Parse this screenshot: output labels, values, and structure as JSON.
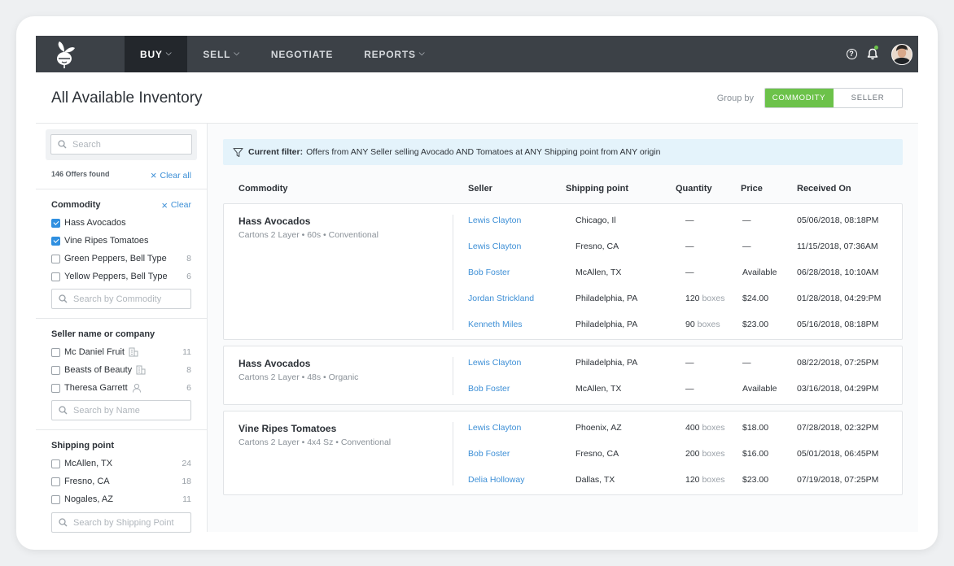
{
  "nav": {
    "items": [
      {
        "label": "BUY",
        "chevron": true
      },
      {
        "label": "SELL",
        "chevron": true
      },
      {
        "label": "NEGOTIATE",
        "chevron": false
      },
      {
        "label": "REPORTS",
        "chevron": true
      }
    ],
    "help_glyph": "?",
    "icons": [
      "help-icon",
      "bell-icon",
      "avatar"
    ]
  },
  "header": {
    "title": "All Available Inventory",
    "group_by_label": "Group by",
    "group_options": [
      "COMMODITY",
      "SELLER"
    ],
    "group_selected": "COMMODITY"
  },
  "sidebar": {
    "search_placeholder": "Search",
    "results_count": "146 Offers found",
    "clear_all": "Clear all",
    "commodity": {
      "title": "Commodity",
      "clear": "Clear",
      "items": [
        {
          "label": "Hass Avocados",
          "checked": true,
          "count": ""
        },
        {
          "label": "Vine Ripes Tomatoes",
          "checked": true,
          "count": ""
        },
        {
          "label": "Green Peppers, Bell Type",
          "checked": false,
          "count": "8"
        },
        {
          "label": "Yellow Peppers, Bell Type",
          "checked": false,
          "count": "6"
        }
      ],
      "search_placeholder": "Search by Commodity"
    },
    "seller": {
      "title": "Seller name or company",
      "items": [
        {
          "label": "Mc Daniel Fruit",
          "icon": "building-icon",
          "checked": false,
          "count": "11"
        },
        {
          "label": "Beasts of Beauty",
          "icon": "building-icon",
          "checked": false,
          "count": "8"
        },
        {
          "label": "Theresa Garrett",
          "icon": "person-icon",
          "checked": false,
          "count": "6"
        }
      ],
      "search_placeholder": "Search by Name"
    },
    "shipping": {
      "title": "Shipping point",
      "items": [
        {
          "label": "McAllen, TX",
          "checked": false,
          "count": "24"
        },
        {
          "label": "Fresno, CA",
          "checked": false,
          "count": "18"
        },
        {
          "label": "Nogales, AZ",
          "checked": false,
          "count": "11"
        }
      ],
      "search_placeholder": "Search by Shipping Point"
    }
  },
  "filter": {
    "label": "Current filter:",
    "text": "Offers from ANY Seller selling Avocado AND Tomatoes at ANY Shipping point from ANY origin"
  },
  "table": {
    "columns": [
      "Commodity",
      "Seller",
      "Shipping point",
      "Quantity",
      "Price",
      "Received On"
    ],
    "groups": [
      {
        "name": "Hass Avocados",
        "desc": "Cartons 2 Layer • 60s • Conventional",
        "rows": [
          {
            "seller": "Lewis Clayton",
            "ship": "Chicago, Il",
            "qty": "—",
            "unit": "",
            "price": "—",
            "received": "05/06/2018, 08:18PM"
          },
          {
            "seller": "Lewis Clayton",
            "ship": "Fresno, CA",
            "qty": "—",
            "unit": "",
            "price": "—",
            "received": "11/15/2018, 07:36AM"
          },
          {
            "seller": "Bob Foster",
            "ship": "McAllen, TX",
            "qty": "—",
            "unit": "",
            "price": "Available",
            "received": "06/28/2018, 10:10AM"
          },
          {
            "seller": "Jordan Strickland",
            "ship": "Philadelphia, PA",
            "qty": "120",
            "unit": "boxes",
            "price": "$24.00",
            "received": "01/28/2018, 04:29:PM"
          },
          {
            "seller": "Kenneth Miles",
            "ship": "Philadelphia, PA",
            "qty": "90",
            "unit": "boxes",
            "price": "$23.00",
            "received": "05/16/2018, 08:18PM"
          }
        ]
      },
      {
        "name": "Hass Avocados",
        "desc": "Cartons 2 Layer • 48s • Organic",
        "rows": [
          {
            "seller": "Lewis Clayton",
            "ship": "Philadelphia, PA",
            "qty": "—",
            "unit": "",
            "price": "—",
            "received": "08/22/2018, 07:25PM"
          },
          {
            "seller": "Bob Foster",
            "ship": "McAllen, TX",
            "qty": "—",
            "unit": "",
            "price": "Available",
            "received": "03/16/2018, 04:29PM"
          }
        ]
      },
      {
        "name": "Vine Ripes Tomatoes",
        "desc": "Cartons 2 Layer • 4x4 Sz • Conventional",
        "rows": [
          {
            "seller": "Lewis Clayton",
            "ship": "Phoenix, AZ",
            "qty": "400",
            "unit": "boxes",
            "price": "$18.00",
            "received": "07/28/2018, 02:32PM"
          },
          {
            "seller": "Bob Foster",
            "ship": "Fresno, CA",
            "qty": "200",
            "unit": "boxes",
            "price": "$16.00",
            "received": "05/01/2018, 06:45PM"
          },
          {
            "seller": "Delia Holloway",
            "ship": "Dallas, TX",
            "qty": "120",
            "unit": "boxes",
            "price": "$23.00",
            "received": "07/19/2018, 07:25PM"
          }
        ]
      }
    ]
  },
  "colors": {
    "nav_bg": "#3c4147",
    "nav_active": "#23272c",
    "accent_green": "#6cc24a",
    "link_blue": "#3d8fd6",
    "filter_bg": "#e4f3fb"
  }
}
